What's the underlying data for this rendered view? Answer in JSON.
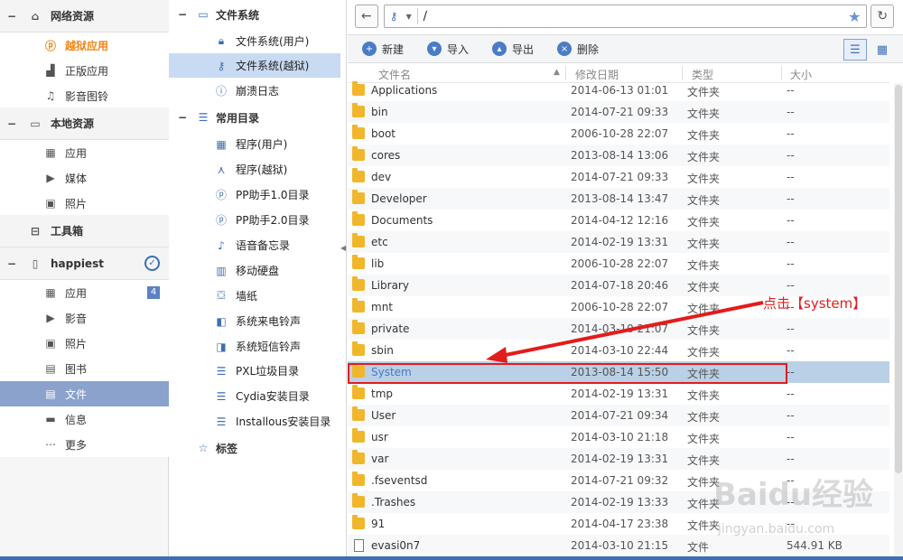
{
  "left": {
    "sections": [
      {
        "label": "网络资源",
        "icon": "home-icon"
      },
      {
        "label": "本地资源",
        "icon": "monitor-icon"
      },
      {
        "label": "工具箱",
        "icon": "toolbox-icon"
      },
      {
        "label": "happiest",
        "icon": "phone-icon"
      }
    ],
    "items": [
      {
        "label": "越狱应用",
        "icon": "pp-logo-icon"
      },
      {
        "label": "正版应用",
        "icon": "app-icon"
      },
      {
        "label": "影音图铃",
        "icon": "music-icon"
      },
      {
        "label": "应用",
        "icon": "grid-icon"
      },
      {
        "label": "媒体",
        "icon": "video-icon"
      },
      {
        "label": "照片",
        "icon": "image-icon"
      },
      {
        "label": "应用",
        "icon": "grid-icon"
      },
      {
        "label": "影音",
        "icon": "video-icon"
      },
      {
        "label": "照片",
        "icon": "image-icon"
      },
      {
        "label": "图书",
        "icon": "book-icon"
      },
      {
        "label": "文件",
        "icon": "file-icon"
      },
      {
        "label": "信息",
        "icon": "message-icon"
      },
      {
        "label": "更多",
        "icon": "more-icon"
      }
    ],
    "app_badge": "4"
  },
  "tree": {
    "sections": [
      {
        "label": "文件系统",
        "icon": "monitor-icon"
      },
      {
        "label": "常用目录",
        "icon": "list-icon"
      },
      {
        "label": "标签",
        "icon": "star-icon"
      }
    ],
    "items": [
      {
        "label": "文件系统(用户)",
        "icon": "lock-icon"
      },
      {
        "label": "文件系统(越狱)",
        "icon": "key-icon"
      },
      {
        "label": "崩溃日志",
        "icon": "alert-icon"
      },
      {
        "label": "程序(用户)",
        "icon": "grid-icon"
      },
      {
        "label": "程序(越狱)",
        "icon": "compass-icon"
      },
      {
        "label": "PP助手1.0目录",
        "icon": "pp-icon"
      },
      {
        "label": "PP助手2.0目录",
        "icon": "pp-icon"
      },
      {
        "label": "语音备忘录",
        "icon": "mic-icon"
      },
      {
        "label": "移动硬盘",
        "icon": "drive-icon"
      },
      {
        "label": "墙纸",
        "icon": "wallpaper-icon"
      },
      {
        "label": "系统来电铃声",
        "icon": "ringtone-icon"
      },
      {
        "label": "系统短信铃声",
        "icon": "sms-ringtone-icon"
      },
      {
        "label": "PXL垃圾目录",
        "icon": "list-icon"
      },
      {
        "label": "Cydia安装目录",
        "icon": "list-icon"
      },
      {
        "label": "Installous安装目录",
        "icon": "list-icon"
      }
    ]
  },
  "address": {
    "path": "/"
  },
  "toolbar": {
    "new": "新建",
    "import": "导入",
    "export": "导出",
    "delete": "删除"
  },
  "table": {
    "headers": [
      "文件名",
      "修改日期",
      "类型",
      "大小"
    ],
    "rows": [
      [
        "Applications",
        "2014-06-13 01:01",
        "文件夹",
        "--"
      ],
      [
        "bin",
        "2014-07-21 09:33",
        "文件夹",
        "--"
      ],
      [
        "boot",
        "2006-10-28 22:07",
        "文件夹",
        "--"
      ],
      [
        "cores",
        "2013-08-14 13:06",
        "文件夹",
        "--"
      ],
      [
        "dev",
        "2014-07-21 09:33",
        "文件夹",
        "--"
      ],
      [
        "Developer",
        "2013-08-14 13:47",
        "文件夹",
        "--"
      ],
      [
        "Documents",
        "2014-04-12 12:16",
        "文件夹",
        "--"
      ],
      [
        "etc",
        "2014-02-19 13:31",
        "文件夹",
        "--"
      ],
      [
        "lib",
        "2006-10-28 22:07",
        "文件夹",
        "--"
      ],
      [
        "Library",
        "2014-07-18 20:46",
        "文件夹",
        "--"
      ],
      [
        "mnt",
        "2006-10-28 22:07",
        "文件夹",
        "--"
      ],
      [
        "private",
        "2014-03-10 21:07",
        "文件夹",
        "--"
      ],
      [
        "sbin",
        "2014-03-10 22:44",
        "文件夹",
        "--"
      ],
      [
        "System",
        "2013-08-14 15:50",
        "文件夹",
        "--"
      ],
      [
        "tmp",
        "2014-02-19 13:31",
        "文件夹",
        "--"
      ],
      [
        "User",
        "2014-07-21 09:34",
        "文件夹",
        "--"
      ],
      [
        "usr",
        "2014-03-10 21:18",
        "文件夹",
        "--"
      ],
      [
        "var",
        "2014-02-19 13:31",
        "文件夹",
        "--"
      ],
      [
        ".fseventsd",
        "2014-07-21 09:32",
        "文件夹",
        "--"
      ],
      [
        ".Trashes",
        "2014-02-19 13:33",
        "文件夹",
        "--"
      ],
      [
        "91",
        "2014-04-17 23:38",
        "文件夹",
        "--"
      ],
      [
        "evasi0n7",
        "2014-03-10 21:15",
        "文件",
        "544.91 KB"
      ]
    ]
  },
  "annotation": "点击【system】",
  "watermark": "Baidu经验",
  "watermark_url": "jingyan.baidu.com",
  "colors": {
    "accent": "#3d6fb3",
    "selected": "#8aa2cc",
    "highlight_row": "#bad0e6",
    "annotation_red": "#e31c1c",
    "orange": "#f08519"
  }
}
